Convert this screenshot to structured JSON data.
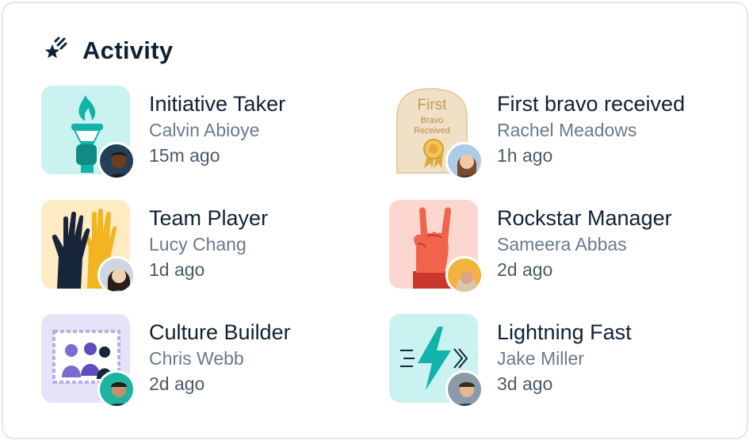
{
  "header": {
    "title": "Activity",
    "icon": "shooting-star-icon"
  },
  "items": [
    {
      "title": "Initiative Taker",
      "name": "Calvin Abioye",
      "time": "15m ago",
      "badge_icon": "torch-icon",
      "badge_bg": "#c9f2f0"
    },
    {
      "title": "First bravo received",
      "name": "Rachel Meadows",
      "time": "1h ago",
      "badge_icon": "first-bravo-plaque-icon",
      "badge_bg": "#ffffff",
      "badge_text": {
        "line1": "First",
        "line2": "Bravo",
        "line3": "Received"
      }
    },
    {
      "title": "Team Player",
      "name": "Lucy Chang",
      "time": "1d ago",
      "badge_icon": "raised-hands-icon",
      "badge_bg": "#fdebc4"
    },
    {
      "title": "Rockstar Manager",
      "name": "Sameera Abbas",
      "time": "2d ago",
      "badge_icon": "rock-hand-icon",
      "badge_bg": "#fcd7d0"
    },
    {
      "title": "Culture Builder",
      "name": "Chris Webb",
      "time": "2d ago",
      "badge_icon": "group-photo-icon",
      "badge_bg": "#e6e2f7"
    },
    {
      "title": "Lightning Fast",
      "name": "Jake Miller",
      "time": "3d ago",
      "badge_icon": "lightning-bolt-icon",
      "badge_bg": "#c9f2f0"
    }
  ]
}
